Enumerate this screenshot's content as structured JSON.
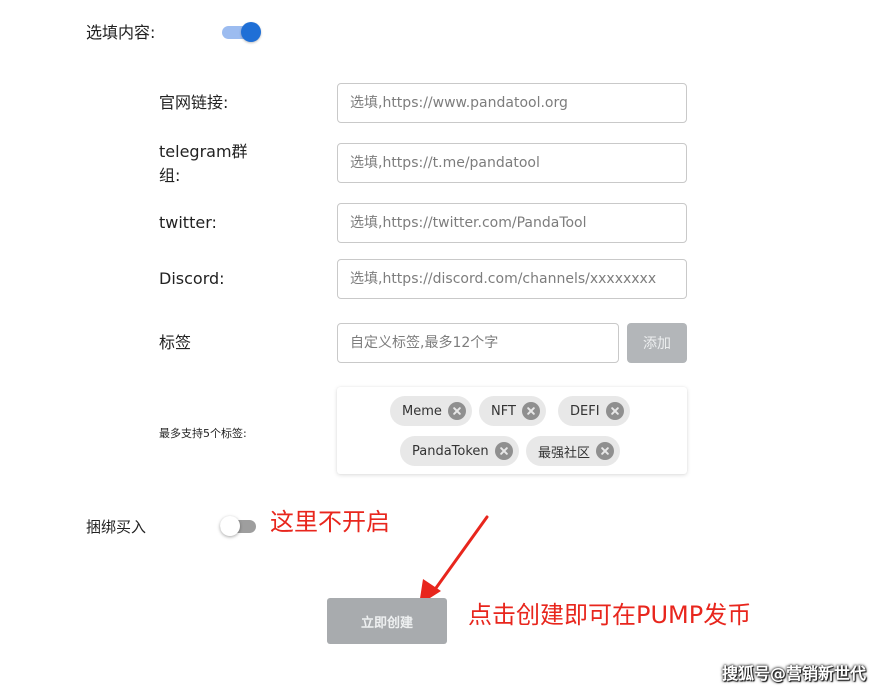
{
  "optional": {
    "label": "选填内容:",
    "toggle_on": true,
    "toggle_color": "#1f6fd6"
  },
  "fields": [
    {
      "label": "官网链接:",
      "placeholder": "选填,https://www.pandatool.org",
      "value": ""
    },
    {
      "label": "telegram群组:",
      "placeholder": "选填,https://t.me/pandatool",
      "value": ""
    },
    {
      "label": "twitter:",
      "placeholder": "选填,https://twitter.com/PandaTool",
      "value": ""
    },
    {
      "label": "Discord:",
      "placeholder": "选填,https://discord.com/channels/xxxxxxxx",
      "value": ""
    }
  ],
  "tags": {
    "label": "标签",
    "placeholder": "自定义标签,最多12个字",
    "value": "",
    "add_label": "添加",
    "max_label": "最多支持5个标签:",
    "items": [
      "Meme",
      "NFT",
      "DEFI",
      "PandaToken",
      "最强社区"
    ]
  },
  "bundle_buy": {
    "label": "捆绑买入",
    "toggle_on": false
  },
  "create_button": {
    "label": "立即创建"
  },
  "annotations": {
    "toggle_note": "这里不开启",
    "create_note": "点击创建即可在PUMP发币",
    "color": "#e8261d"
  },
  "watermark": "搜狐号@营销新世代"
}
